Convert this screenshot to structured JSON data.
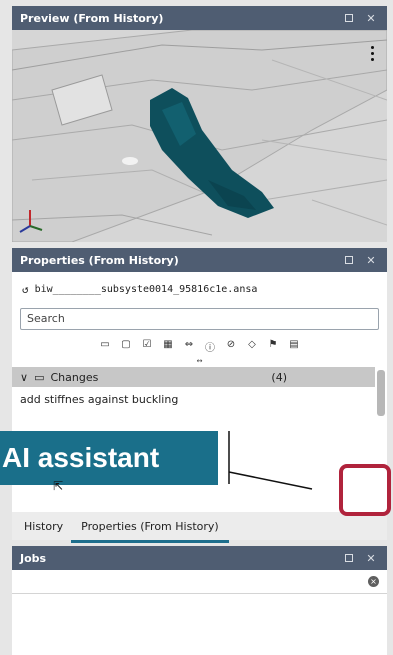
{
  "preview": {
    "title": "Preview (From History)",
    "float_icon": "float-window-icon",
    "close": "✕"
  },
  "properties": {
    "title": "Properties (From History)",
    "close": "✕",
    "file_icon": "revert-icon",
    "filename": "biw________subsyste0014_95816c1e.ansa",
    "search_placeholder": "Search",
    "toolbar_icons": [
      "comment-icon",
      "comment-outline-icon",
      "checkbox-icon",
      "grid-icon",
      "diff-icon",
      "info-icon",
      "attach-icon",
      "code-icon",
      "flag-icon",
      "document-icon"
    ],
    "splitter": "↔",
    "section": {
      "chevron": "∨",
      "icon": "comment-icon",
      "label": "Changes",
      "count": "(4)",
      "text": "add stiffnes against buckling"
    },
    "ai_button_icon": "sparkle-icon"
  },
  "tabs": [
    {
      "label": "History"
    },
    {
      "label": "Properties (From History)"
    }
  ],
  "jobs": {
    "title": "Jobs",
    "close": "✕",
    "clear": "×"
  },
  "callout": {
    "label": "AI assistant"
  }
}
